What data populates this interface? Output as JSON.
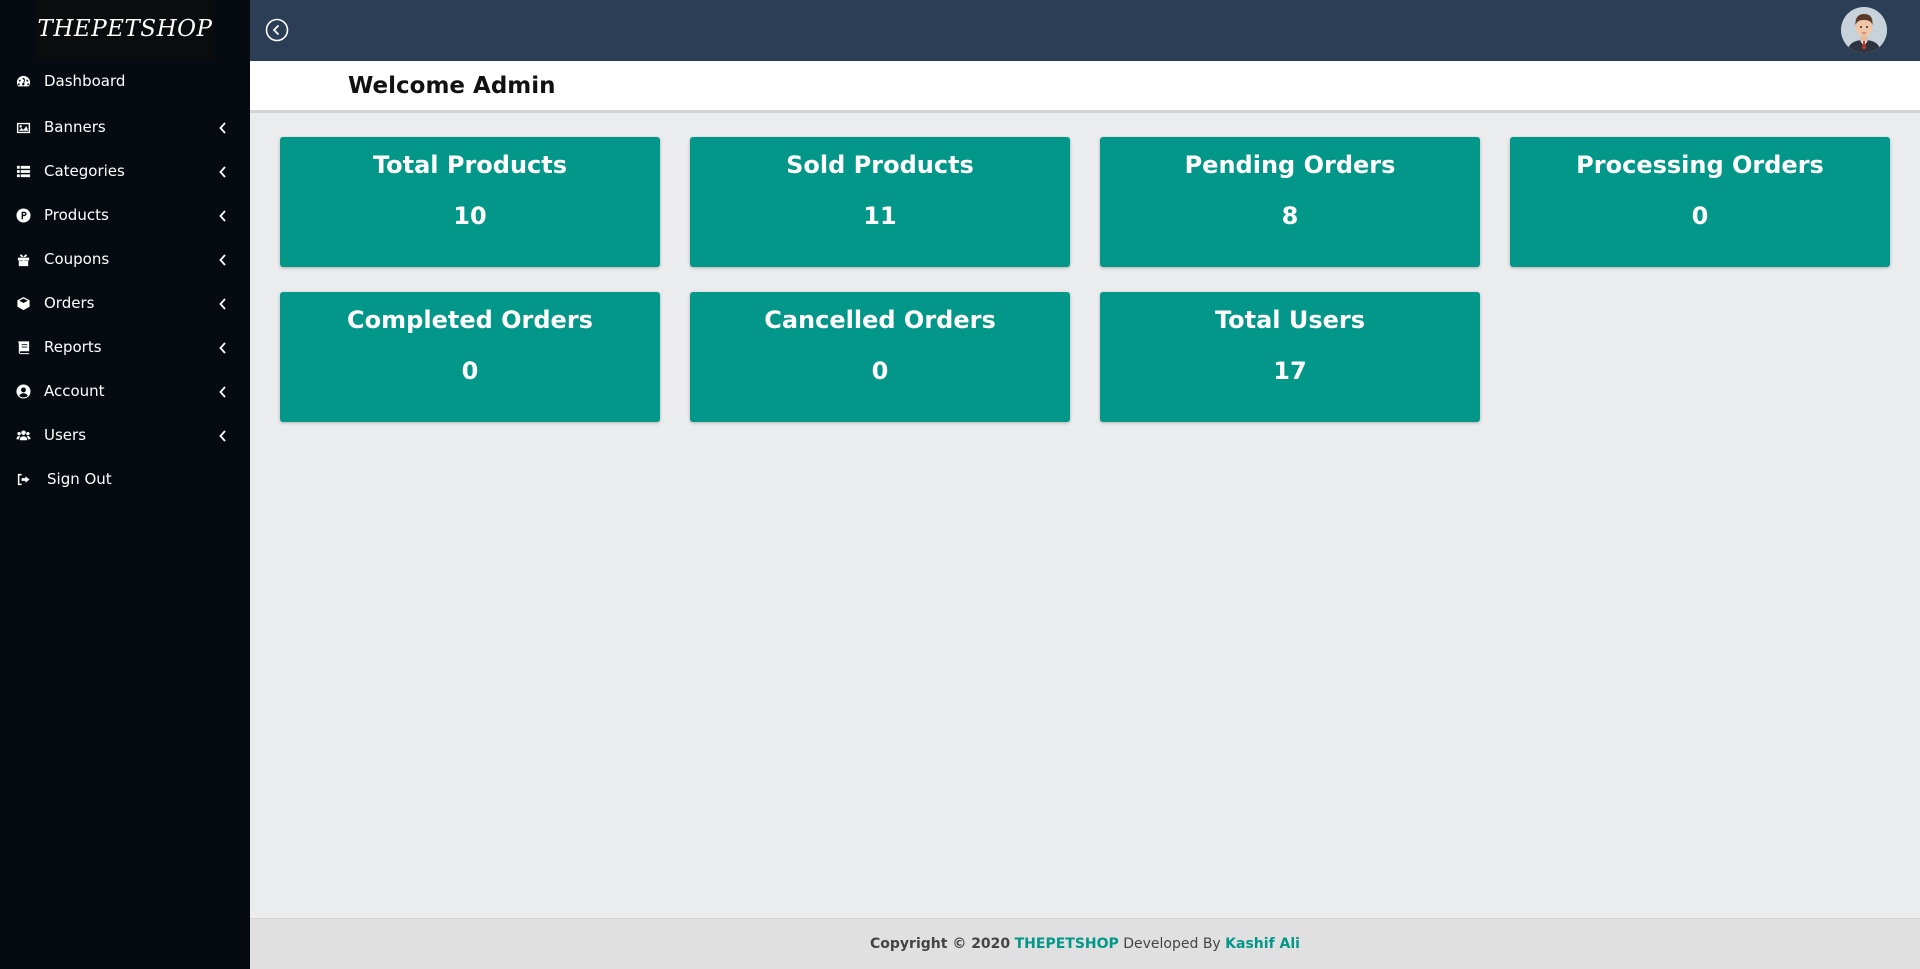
{
  "brand": {
    "name": "THEPETSHOP"
  },
  "sidebar": {
    "items": [
      {
        "label": "Dashboard",
        "icon": "dashboard-icon",
        "has_chevron": false
      },
      {
        "label": "Banners",
        "icon": "image-icon",
        "has_chevron": true
      },
      {
        "label": "Categories",
        "icon": "list-icon",
        "has_chevron": true
      },
      {
        "label": "Products",
        "icon": "product-badge-icon",
        "has_chevron": true
      },
      {
        "label": "Coupons",
        "icon": "gift-icon",
        "has_chevron": true
      },
      {
        "label": "Orders",
        "icon": "box-icon",
        "has_chevron": true
      },
      {
        "label": "Reports",
        "icon": "book-icon",
        "has_chevron": true
      },
      {
        "label": "Account",
        "icon": "user-circle-icon",
        "has_chevron": true
      },
      {
        "label": "Users",
        "icon": "users-icon",
        "has_chevron": true
      },
      {
        "label": "Sign Out",
        "icon": "sign-out-icon",
        "has_chevron": false
      }
    ]
  },
  "topbar": {
    "toggle_icon": "chevron-left-circle-icon",
    "avatar_icon": "user-avatar"
  },
  "welcome": {
    "title": "Welcome Admin"
  },
  "stats": [
    {
      "label": "Total Products",
      "value": "10"
    },
    {
      "label": "Sold Products",
      "value": "11"
    },
    {
      "label": "Pending Orders",
      "value": "8"
    },
    {
      "label": "Processing Orders",
      "value": "0"
    },
    {
      "label": "Completed Orders",
      "value": "0"
    },
    {
      "label": "Cancelled Orders",
      "value": "0"
    },
    {
      "label": "Total Users",
      "value": "17"
    }
  ],
  "footer": {
    "copyright": "Copyright © 2020",
    "brand": "THEPETSHOP",
    "developed_by": "Developed By",
    "developer": "Kashif Ali"
  },
  "colors": {
    "sidebar_bg": "#050b11",
    "topbar_bg": "#2c3e55",
    "card_bg": "#029788",
    "accent": "#029788",
    "content_bg": "#ebecee"
  }
}
